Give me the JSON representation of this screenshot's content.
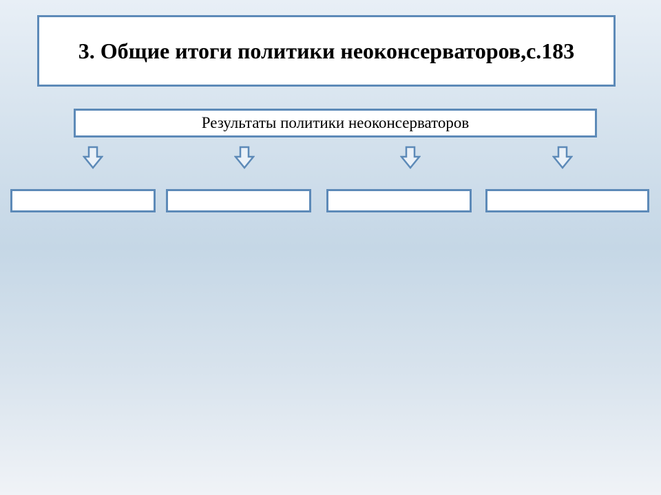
{
  "title": "3. Общие итоги политики неоконсерваторов,с.183",
  "subtitle": "Результаты политики неоконсерваторов",
  "results": [
    "",
    "",
    "",
    ""
  ],
  "style": {
    "borderColor": "#5d8ab8",
    "boxFill": "#ffffff"
  }
}
